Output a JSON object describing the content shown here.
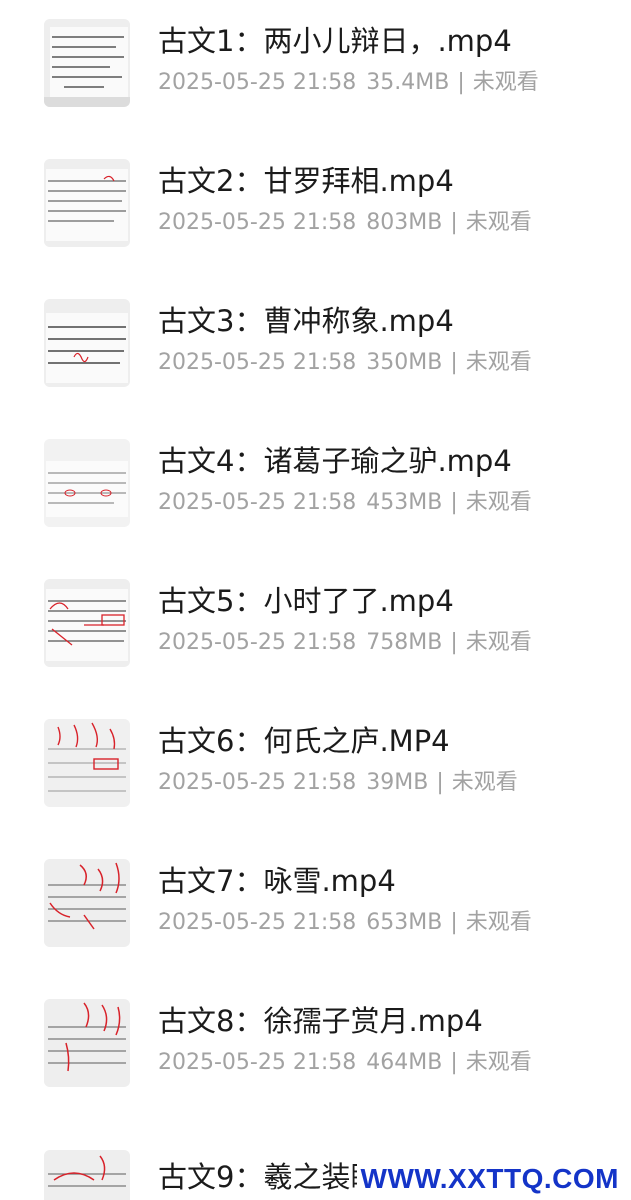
{
  "files": [
    {
      "name": "古文1：两小儿辩日，.mp4",
      "date": "2025-05-25 21:58",
      "size": "35.4MB",
      "status": "未观看"
    },
    {
      "name": "古文2：甘罗拜相.mp4",
      "date": "2025-05-25 21:58",
      "size": "803MB",
      "status": "未观看"
    },
    {
      "name": "古文3：曹冲称象.mp4",
      "date": "2025-05-25 21:58",
      "size": "350MB",
      "status": "未观看"
    },
    {
      "name": "古文4：诸葛子瑜之驴.mp4",
      "date": "2025-05-25 21:58",
      "size": "453MB",
      "status": "未观看"
    },
    {
      "name": "古文5：小时了了.mp4",
      "date": "2025-05-25 21:58",
      "size": "758MB",
      "status": "未观看"
    },
    {
      "name": "古文6：何氏之庐.MP4",
      "date": "2025-05-25 21:58",
      "size": "39MB",
      "status": "未观看"
    },
    {
      "name": "古文7：咏雪.mp4",
      "date": "2025-05-25 21:58",
      "size": "653MB",
      "status": "未观看"
    },
    {
      "name": "古文8：徐孺子赏月.mp4",
      "date": "2025-05-25 21:58",
      "size": "464MB",
      "status": "未观看"
    },
    {
      "name": "古文9：羲之装睡.mp4",
      "date": "",
      "size": "",
      "status": ""
    }
  ],
  "meta_separator": "|",
  "thumbnail_icon": "handwritten-notes-thumbnail",
  "watermark": "WWW.XXTTQ.COM",
  "colors": {
    "title": "#1b1b1b",
    "meta": "#a2a2a2",
    "watermark": "#1434c8",
    "annotation_red": "#d8222a"
  }
}
